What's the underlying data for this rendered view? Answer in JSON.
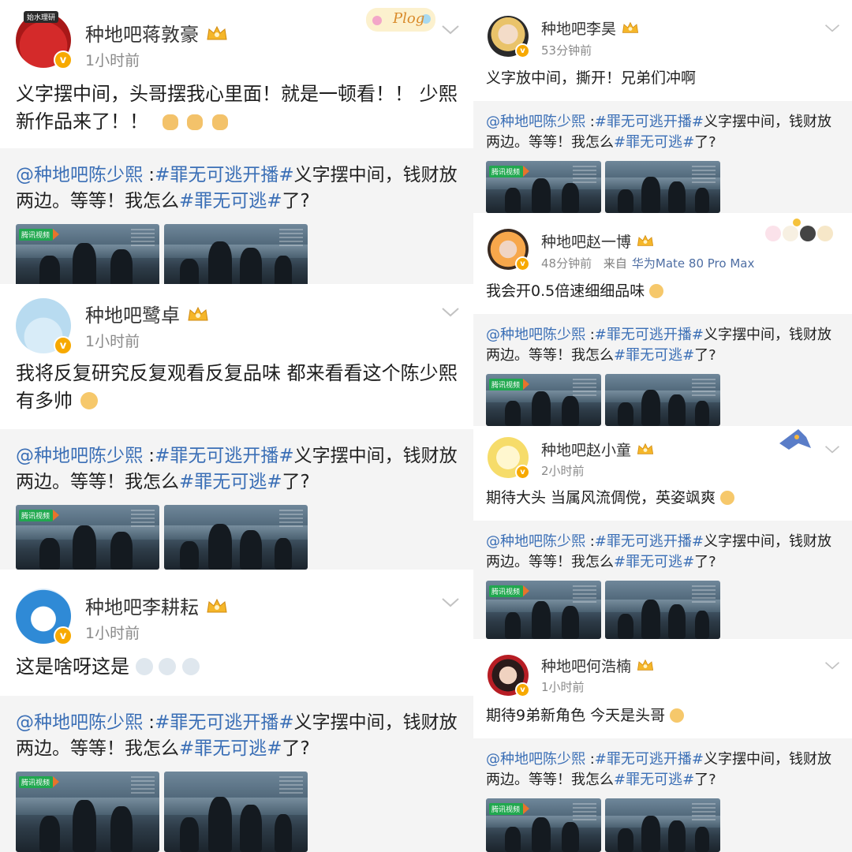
{
  "repost": {
    "at": "@种地吧陈少熙",
    "sep": " :",
    "tag1": "#罪无可逃开播#",
    "mid": "义字摆中间，钱财放两边。等等！我怎么",
    "tag2": "#罪无可逃#",
    "end": "了?",
    "video_logo": "腾讯视频"
  },
  "left_posts": [
    {
      "username": "种地吧蒋敦豪",
      "time": "1小时前",
      "text": "义字摆中间，头哥摆我心里面！就是一顿看！！ 少熙新作品来了！！",
      "avatar_tag": "始水理研",
      "sticker_text": "Plog"
    },
    {
      "username": "种地吧鹭卓",
      "time": "1小时前",
      "text": "我将反复研究反复观看反复品味 都来看看这个陈少熙有多帅"
    },
    {
      "username": "种地吧李耕耘",
      "time": "1小时前",
      "text": "这是啥呀这是"
    }
  ],
  "right_posts": [
    {
      "username": "种地吧李昊",
      "time": "53分钟前",
      "text": "义字放中间，撕开！兄弟们冲啊"
    },
    {
      "username": "种地吧赵一博",
      "time": "48分钟前",
      "source_prefix": "来自",
      "source": "华为Mate 80 Pro Max",
      "text": "我会开0.5倍速细细品味"
    },
    {
      "username": "种地吧赵小童",
      "time": "2小时前",
      "text": "期待大头  当属风流倜傥，英姿飒爽"
    },
    {
      "username": "种地吧何浩楠",
      "time": "1小时前",
      "text": "期待9弟新角色  今天是头哥"
    }
  ],
  "colors": {
    "link": "#3b6fb6",
    "badge": "#f7a900",
    "repost_bg": "#f4f4f4",
    "meta": "#8a8a8a"
  },
  "icons": [
    "chevron-down-icon",
    "verified-badge-icon",
    "crown-badge-icon",
    "emoji-icon",
    "tencent-video-logo"
  ]
}
